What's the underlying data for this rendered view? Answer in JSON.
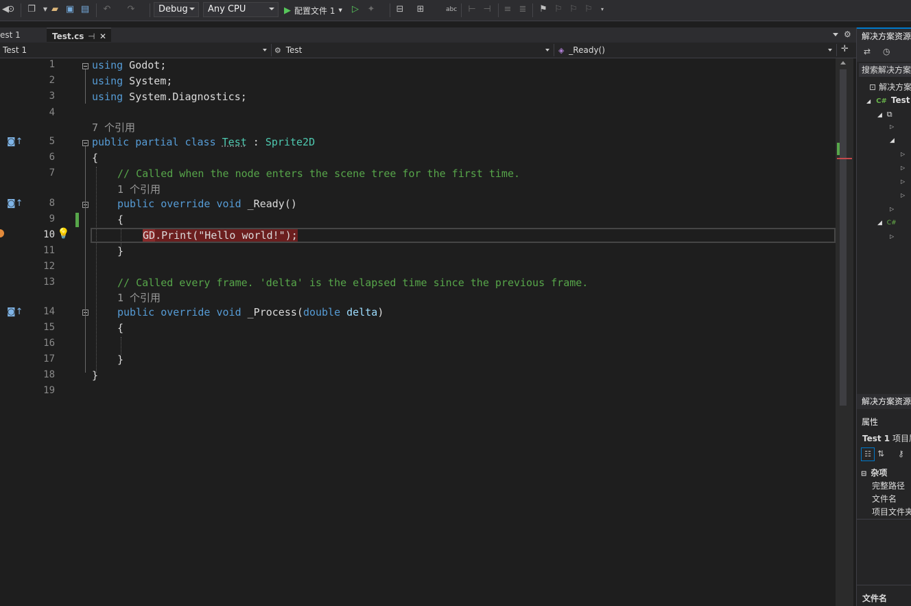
{
  "toolbar": {
    "config": "Debug",
    "platform": "Any CPU",
    "run_label": "配置文件 1"
  },
  "tabs": [
    {
      "label": "est 1"
    },
    {
      "label": "Test.cs",
      "pin": "⊣",
      "close": "✕"
    }
  ],
  "navbar": {
    "project": "Test 1",
    "class": "Test",
    "member": "_Ready()"
  },
  "code": {
    "l1_using": "using",
    "l1_rest": " Godot;",
    "l2_using": "using",
    "l2_rest": " System;",
    "l3_using": "using",
    "l3_rest": " System.Diagnostics;",
    "lens_7": "7 个引用",
    "l5_kw": "public partial class",
    "l5_sp": " ",
    "l5_ty": "Test",
    "l5_colon": " : ",
    "l5_base": "Sprite2D",
    "l6": "{",
    "l7_comment": "// Called when the node enters the scene tree for the first time.",
    "lens_1a": "1 个引用",
    "l8_kw": "public override void",
    "l8_fn": " _Ready",
    "l8_paren": "()",
    "l9": "{",
    "l10_gd": "GD",
    "l10_print": ".Print(",
    "l10_str": "\"Hello world!\"",
    "l10_end": ");",
    "l11": "}",
    "l13_comment": "// Called every frame. 'delta' is the elapsed time since the previous frame.",
    "lens_1b": "1 个引用",
    "l14_kw": "public override void",
    "l14_fn": " _Process",
    "l14_open": "(",
    "l14_type": "double",
    "l14_param": " delta",
    "l14_close": ")",
    "l15": "{",
    "l17": "}",
    "l18": "}"
  },
  "line_numbers": [
    "1",
    "2",
    "3",
    "4",
    "5",
    "6",
    "7",
    "8",
    "9",
    "10",
    "11",
    "12",
    "13",
    "14",
    "15",
    "16",
    "17",
    "18",
    "19"
  ],
  "panel": {
    "title1": "解决方案资源",
    "search": "搜索解决方案",
    "solution_node": "解决方案",
    "project_node": "Test",
    "title2": "解决方案资源",
    "props_tab": "属性",
    "props_object_bold": "Test 1",
    "props_object_rest": " 项目属",
    "category": "杂项",
    "prop1": "完整路径",
    "prop2": "文件名",
    "prop3": "项目文件夹",
    "desc_title": "文件名"
  },
  "colors": {
    "background": "#1e1e1e",
    "keyword": "#569cd6",
    "type": "#4ec9b0",
    "comment": "#57a64a",
    "string": "#d69d85",
    "error_highlight": "#6b1e1e",
    "change_bar": "#57a64a"
  }
}
